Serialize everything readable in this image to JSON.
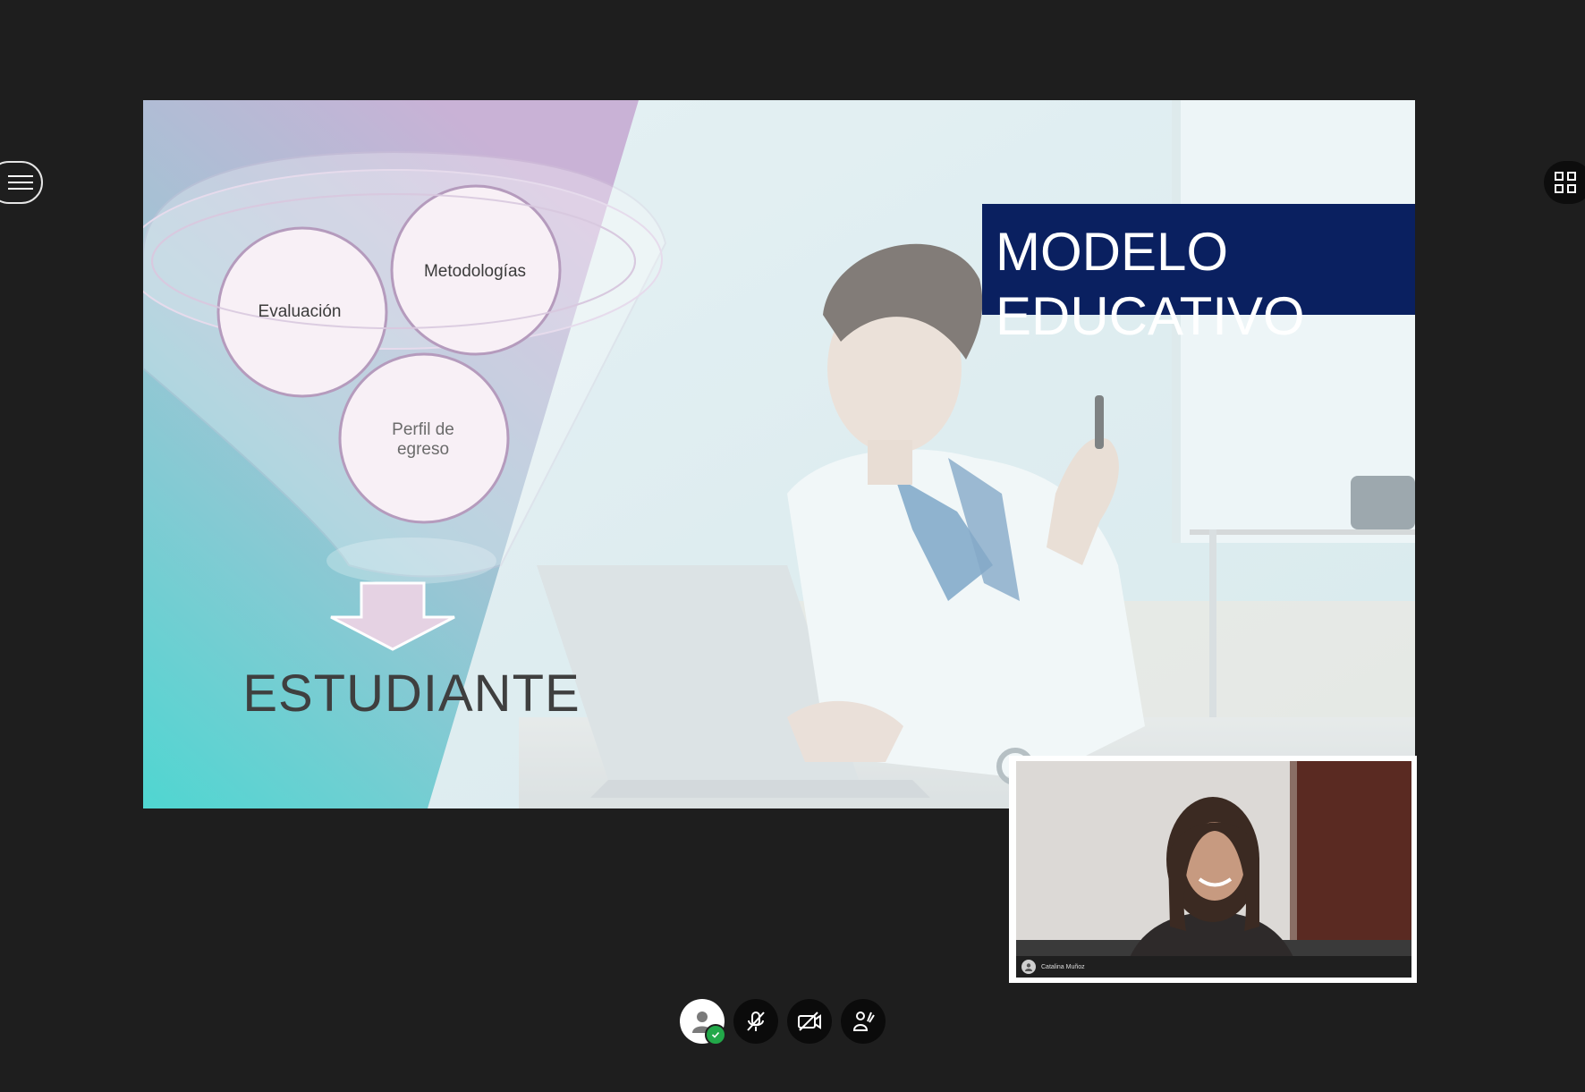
{
  "app": {
    "menu_icon": "hamburger-icon",
    "layout_icon": "grid-layout-icon"
  },
  "slide": {
    "title": "MODELO\nEDUCATIVO",
    "funnel_items": [
      "Evaluación",
      "Metodologías",
      "Perfil de\negreso"
    ],
    "result_label": "ESTUDIANTE",
    "title_box_color": "#0a2060"
  },
  "participant": {
    "name": "Catalina Muñoz"
  },
  "controls": {
    "avatar_icon": "user-avatar-icon",
    "status_icon": "check-icon",
    "mic_icon": "microphone-muted-icon",
    "camera_icon": "camera-off-icon",
    "raise_hand_icon": "raise-hand-icon"
  }
}
